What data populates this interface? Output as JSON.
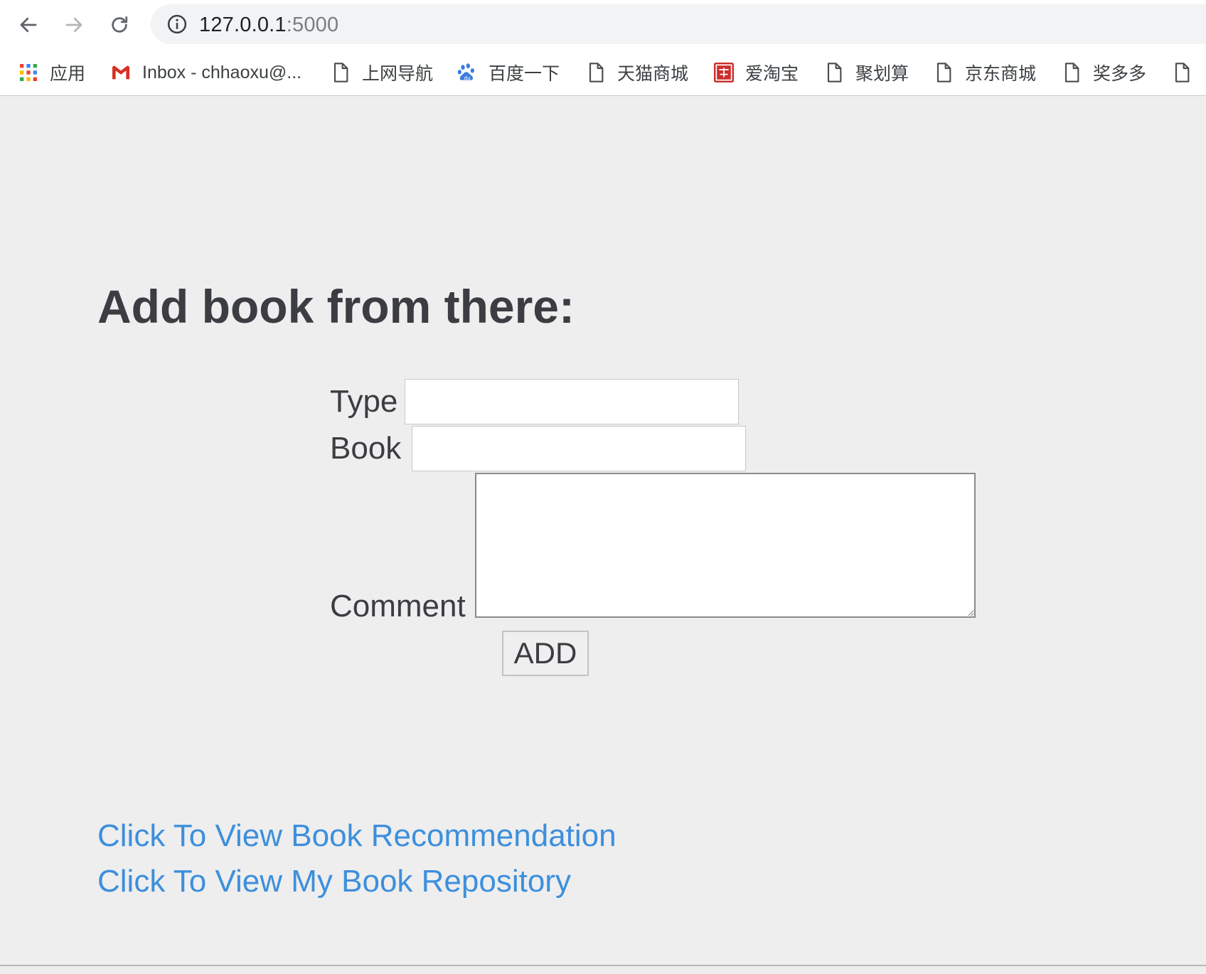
{
  "browser": {
    "url_host": "127.0.0.1",
    "url_port": ":5000",
    "bookmarks": [
      {
        "label": "应用",
        "icon": "apps-grid-icon"
      },
      {
        "label": "Inbox - chhaoxu@...",
        "icon": "gmail-icon"
      },
      {
        "label": "上网导航",
        "icon": "page-icon"
      },
      {
        "label": "百度一下",
        "icon": "baidu-paw-icon"
      },
      {
        "label": "天猫商城",
        "icon": "page-icon"
      },
      {
        "label": "爱淘宝",
        "icon": "taobao-icon"
      },
      {
        "label": "聚划算",
        "icon": "page-icon"
      },
      {
        "label": "京东商城",
        "icon": "page-icon"
      },
      {
        "label": "奖多多",
        "icon": "page-icon"
      }
    ]
  },
  "page": {
    "title": "Add book from there:",
    "form": {
      "type_label": "Type",
      "type_value": "",
      "book_label": "Book",
      "book_value": "",
      "comment_label": "Comment",
      "comment_value": "",
      "submit_label": "ADD"
    },
    "links": {
      "recommendation": "Click To View Book Recommendation",
      "repository": "Click To View My Book Repository"
    }
  },
  "colors": {
    "page_background": "#eeeeee",
    "link": "#3d8fdc",
    "text": "#3b3d42"
  }
}
